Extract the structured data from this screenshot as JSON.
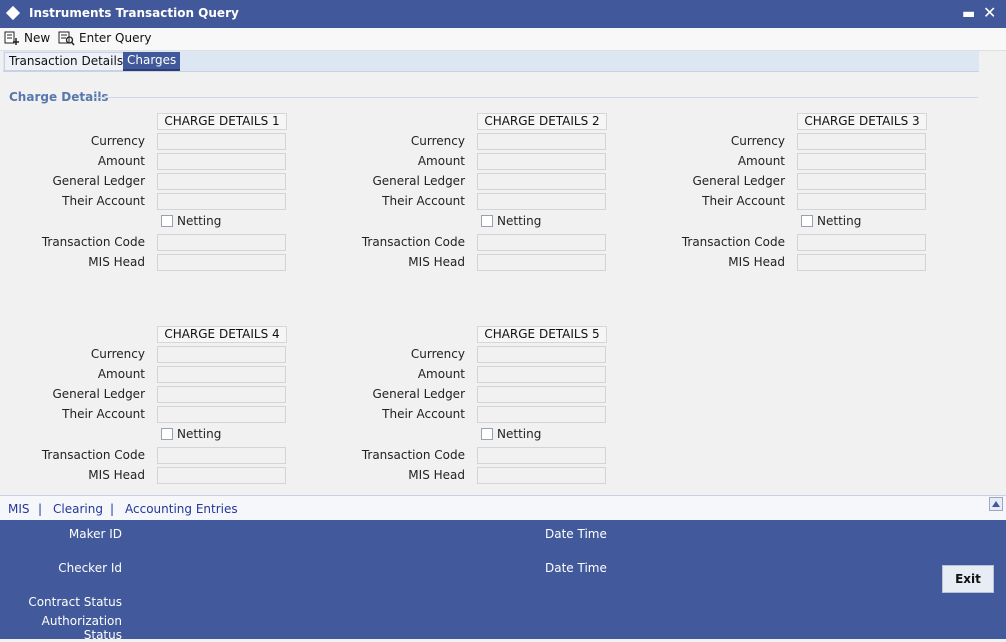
{
  "window": {
    "title": "Instruments Transaction Query",
    "minimize_glyph": "▬",
    "close_glyph": "✕"
  },
  "toolbar": {
    "new_label": "New",
    "enter_query_label": "Enter Query"
  },
  "tabs": [
    {
      "label": "Transaction Details"
    },
    {
      "label": "Charges"
    }
  ],
  "section": {
    "title": "Charge Details"
  },
  "charge_details": [
    {
      "header": "CHARGE DETAILS 1"
    },
    {
      "header": "CHARGE DETAILS 2"
    },
    {
      "header": "CHARGE DETAILS 3"
    },
    {
      "header": "CHARGE DETAILS 4"
    },
    {
      "header": "CHARGE DETAILS 5"
    }
  ],
  "labels": {
    "currency": "Currency",
    "amount": "Amount",
    "general_ledger": "General Ledger",
    "their_account": "Their Account",
    "netting": "Netting",
    "transaction_code": "Transaction Code",
    "mis_head": "MIS Head"
  },
  "bottom_links": {
    "mis": "MIS",
    "clearing": "Clearing",
    "accounting_entries": "Accounting Entries",
    "separator": "|"
  },
  "footer": {
    "maker_id": "Maker ID",
    "checker_id": "Checker Id",
    "date_time": "Date Time",
    "contract_status": "Contract Status",
    "authorization_status": "Authorization Status",
    "exit_label": "Exit"
  },
  "colors": {
    "titlebar": "#41589a",
    "footer": "#42599b",
    "link": "#23379a",
    "section_title": "#5878ad"
  }
}
